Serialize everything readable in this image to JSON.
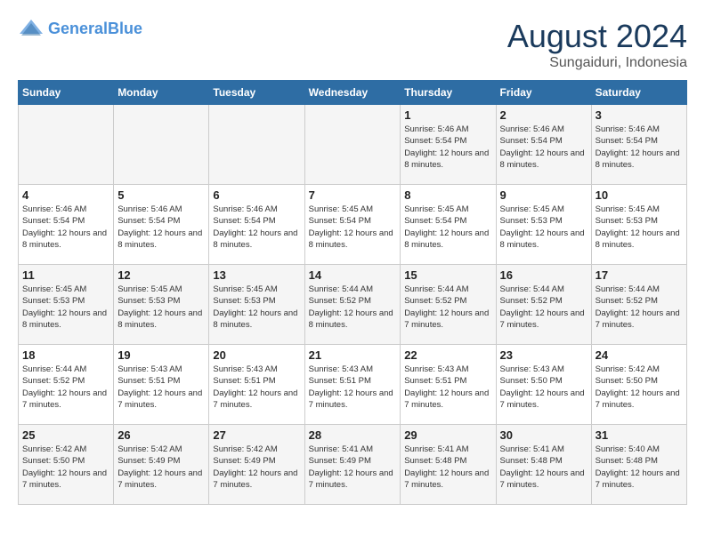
{
  "header": {
    "logo_general": "General",
    "logo_blue": "Blue",
    "month_year": "August 2024",
    "location": "Sungaiduri, Indonesia"
  },
  "weekdays": [
    "Sunday",
    "Monday",
    "Tuesday",
    "Wednesday",
    "Thursday",
    "Friday",
    "Saturday"
  ],
  "weeks": [
    [
      {
        "day": "",
        "sunrise": "",
        "sunset": "",
        "daylight": ""
      },
      {
        "day": "",
        "sunrise": "",
        "sunset": "",
        "daylight": ""
      },
      {
        "day": "",
        "sunrise": "",
        "sunset": "",
        "daylight": ""
      },
      {
        "day": "",
        "sunrise": "",
        "sunset": "",
        "daylight": ""
      },
      {
        "day": "1",
        "sunrise": "Sunrise: 5:46 AM",
        "sunset": "Sunset: 5:54 PM",
        "daylight": "Daylight: 12 hours and 8 minutes."
      },
      {
        "day": "2",
        "sunrise": "Sunrise: 5:46 AM",
        "sunset": "Sunset: 5:54 PM",
        "daylight": "Daylight: 12 hours and 8 minutes."
      },
      {
        "day": "3",
        "sunrise": "Sunrise: 5:46 AM",
        "sunset": "Sunset: 5:54 PM",
        "daylight": "Daylight: 12 hours and 8 minutes."
      }
    ],
    [
      {
        "day": "4",
        "sunrise": "Sunrise: 5:46 AM",
        "sunset": "Sunset: 5:54 PM",
        "daylight": "Daylight: 12 hours and 8 minutes."
      },
      {
        "day": "5",
        "sunrise": "Sunrise: 5:46 AM",
        "sunset": "Sunset: 5:54 PM",
        "daylight": "Daylight: 12 hours and 8 minutes."
      },
      {
        "day": "6",
        "sunrise": "Sunrise: 5:46 AM",
        "sunset": "Sunset: 5:54 PM",
        "daylight": "Daylight: 12 hours and 8 minutes."
      },
      {
        "day": "7",
        "sunrise": "Sunrise: 5:45 AM",
        "sunset": "Sunset: 5:54 PM",
        "daylight": "Daylight: 12 hours and 8 minutes."
      },
      {
        "day": "8",
        "sunrise": "Sunrise: 5:45 AM",
        "sunset": "Sunset: 5:54 PM",
        "daylight": "Daylight: 12 hours and 8 minutes."
      },
      {
        "day": "9",
        "sunrise": "Sunrise: 5:45 AM",
        "sunset": "Sunset: 5:53 PM",
        "daylight": "Daylight: 12 hours and 8 minutes."
      },
      {
        "day": "10",
        "sunrise": "Sunrise: 5:45 AM",
        "sunset": "Sunset: 5:53 PM",
        "daylight": "Daylight: 12 hours and 8 minutes."
      }
    ],
    [
      {
        "day": "11",
        "sunrise": "Sunrise: 5:45 AM",
        "sunset": "Sunset: 5:53 PM",
        "daylight": "Daylight: 12 hours and 8 minutes."
      },
      {
        "day": "12",
        "sunrise": "Sunrise: 5:45 AM",
        "sunset": "Sunset: 5:53 PM",
        "daylight": "Daylight: 12 hours and 8 minutes."
      },
      {
        "day": "13",
        "sunrise": "Sunrise: 5:45 AM",
        "sunset": "Sunset: 5:53 PM",
        "daylight": "Daylight: 12 hours and 8 minutes."
      },
      {
        "day": "14",
        "sunrise": "Sunrise: 5:44 AM",
        "sunset": "Sunset: 5:52 PM",
        "daylight": "Daylight: 12 hours and 8 minutes."
      },
      {
        "day": "15",
        "sunrise": "Sunrise: 5:44 AM",
        "sunset": "Sunset: 5:52 PM",
        "daylight": "Daylight: 12 hours and 7 minutes."
      },
      {
        "day": "16",
        "sunrise": "Sunrise: 5:44 AM",
        "sunset": "Sunset: 5:52 PM",
        "daylight": "Daylight: 12 hours and 7 minutes."
      },
      {
        "day": "17",
        "sunrise": "Sunrise: 5:44 AM",
        "sunset": "Sunset: 5:52 PM",
        "daylight": "Daylight: 12 hours and 7 minutes."
      }
    ],
    [
      {
        "day": "18",
        "sunrise": "Sunrise: 5:44 AM",
        "sunset": "Sunset: 5:52 PM",
        "daylight": "Daylight: 12 hours and 7 minutes."
      },
      {
        "day": "19",
        "sunrise": "Sunrise: 5:43 AM",
        "sunset": "Sunset: 5:51 PM",
        "daylight": "Daylight: 12 hours and 7 minutes."
      },
      {
        "day": "20",
        "sunrise": "Sunrise: 5:43 AM",
        "sunset": "Sunset: 5:51 PM",
        "daylight": "Daylight: 12 hours and 7 minutes."
      },
      {
        "day": "21",
        "sunrise": "Sunrise: 5:43 AM",
        "sunset": "Sunset: 5:51 PM",
        "daylight": "Daylight: 12 hours and 7 minutes."
      },
      {
        "day": "22",
        "sunrise": "Sunrise: 5:43 AM",
        "sunset": "Sunset: 5:51 PM",
        "daylight": "Daylight: 12 hours and 7 minutes."
      },
      {
        "day": "23",
        "sunrise": "Sunrise: 5:43 AM",
        "sunset": "Sunset: 5:50 PM",
        "daylight": "Daylight: 12 hours and 7 minutes."
      },
      {
        "day": "24",
        "sunrise": "Sunrise: 5:42 AM",
        "sunset": "Sunset: 5:50 PM",
        "daylight": "Daylight: 12 hours and 7 minutes."
      }
    ],
    [
      {
        "day": "25",
        "sunrise": "Sunrise: 5:42 AM",
        "sunset": "Sunset: 5:50 PM",
        "daylight": "Daylight: 12 hours and 7 minutes."
      },
      {
        "day": "26",
        "sunrise": "Sunrise: 5:42 AM",
        "sunset": "Sunset: 5:49 PM",
        "daylight": "Daylight: 12 hours and 7 minutes."
      },
      {
        "day": "27",
        "sunrise": "Sunrise: 5:42 AM",
        "sunset": "Sunset: 5:49 PM",
        "daylight": "Daylight: 12 hours and 7 minutes."
      },
      {
        "day": "28",
        "sunrise": "Sunrise: 5:41 AM",
        "sunset": "Sunset: 5:49 PM",
        "daylight": "Daylight: 12 hours and 7 minutes."
      },
      {
        "day": "29",
        "sunrise": "Sunrise: 5:41 AM",
        "sunset": "Sunset: 5:48 PM",
        "daylight": "Daylight: 12 hours and 7 minutes."
      },
      {
        "day": "30",
        "sunrise": "Sunrise: 5:41 AM",
        "sunset": "Sunset: 5:48 PM",
        "daylight": "Daylight: 12 hours and 7 minutes."
      },
      {
        "day": "31",
        "sunrise": "Sunrise: 5:40 AM",
        "sunset": "Sunset: 5:48 PM",
        "daylight": "Daylight: 12 hours and 7 minutes."
      }
    ]
  ]
}
